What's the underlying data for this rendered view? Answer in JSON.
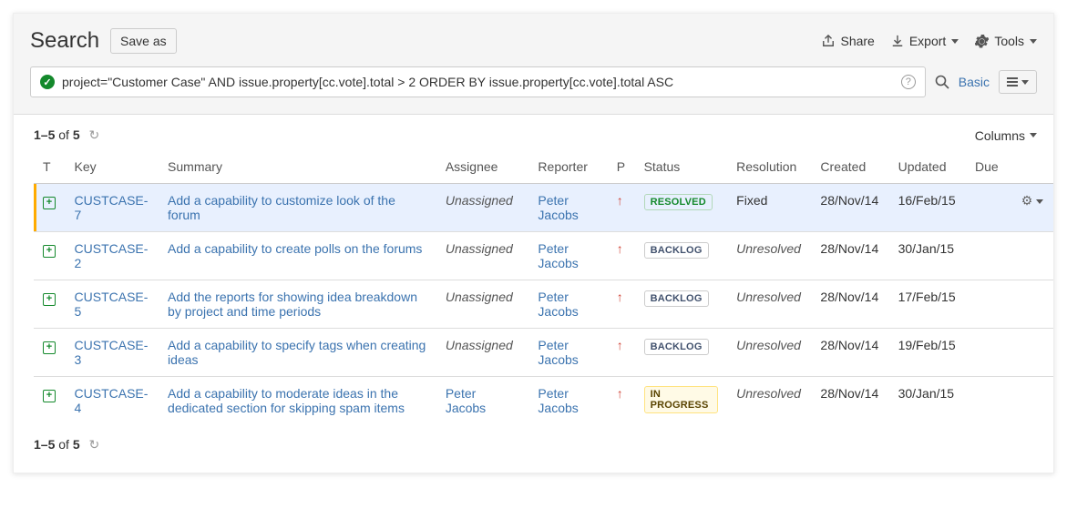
{
  "header": {
    "title": "Search",
    "saveAs": "Save as",
    "share": "Share",
    "export": "Export",
    "tools": "Tools"
  },
  "query": {
    "value": "project=\"Customer Case\" AND issue.property[cc.vote].total > 2 ORDER BY issue.property[cc.vote].total ASC",
    "basic": "Basic"
  },
  "results": {
    "range": "1–5",
    "of": "of",
    "total": "5",
    "columns": "Columns"
  },
  "columns": {
    "t": "T",
    "key": "Key",
    "summary": "Summary",
    "assignee": "Assignee",
    "reporter": "Reporter",
    "p": "P",
    "status": "Status",
    "resolution": "Resolution",
    "created": "Created",
    "updated": "Updated",
    "due": "Due"
  },
  "rows": [
    {
      "key": "CUSTCASE-7",
      "summary": "Add a capability to customize look of the forum",
      "assignee": "Unassigned",
      "reporter": "Peter Jacobs",
      "priorityIcon": "↑",
      "status": "RESOLVED",
      "statusClass": "resolved",
      "resolution": "Fixed",
      "created": "28/Nov/14",
      "updated": "16/Feb/15",
      "due": "",
      "highlight": true
    },
    {
      "key": "CUSTCASE-2",
      "summary": "Add a capability to create polls on the forums",
      "assignee": "Unassigned",
      "reporter": "Peter Jacobs",
      "priorityIcon": "↑",
      "status": "BACKLOG",
      "statusClass": "backlog",
      "resolution": "Unresolved",
      "created": "28/Nov/14",
      "updated": "30/Jan/15",
      "due": ""
    },
    {
      "key": "CUSTCASE-5",
      "summary": "Add the reports for showing idea breakdown by project and time periods",
      "assignee": "Unassigned",
      "reporter": "Peter Jacobs",
      "priorityIcon": "↑",
      "status": "BACKLOG",
      "statusClass": "backlog",
      "resolution": "Unresolved",
      "created": "28/Nov/14",
      "updated": "17/Feb/15",
      "due": ""
    },
    {
      "key": "CUSTCASE-3",
      "summary": "Add a capability to specify tags when creating ideas",
      "assignee": "Unassigned",
      "reporter": "Peter Jacobs",
      "priorityIcon": "↑",
      "status": "BACKLOG",
      "statusClass": "backlog",
      "resolution": "Unresolved",
      "created": "28/Nov/14",
      "updated": "19/Feb/15",
      "due": ""
    },
    {
      "key": "CUSTCASE-4",
      "summary": "Add a capability to moderate ideas in the dedicated section for skipping spam items",
      "assignee": "Peter Jacobs",
      "reporter": "Peter Jacobs",
      "priorityIcon": "↑",
      "status": "IN PROGRESS",
      "statusClass": "inprogress",
      "resolution": "Unresolved",
      "created": "28/Nov/14",
      "updated": "30/Jan/15",
      "due": ""
    }
  ]
}
